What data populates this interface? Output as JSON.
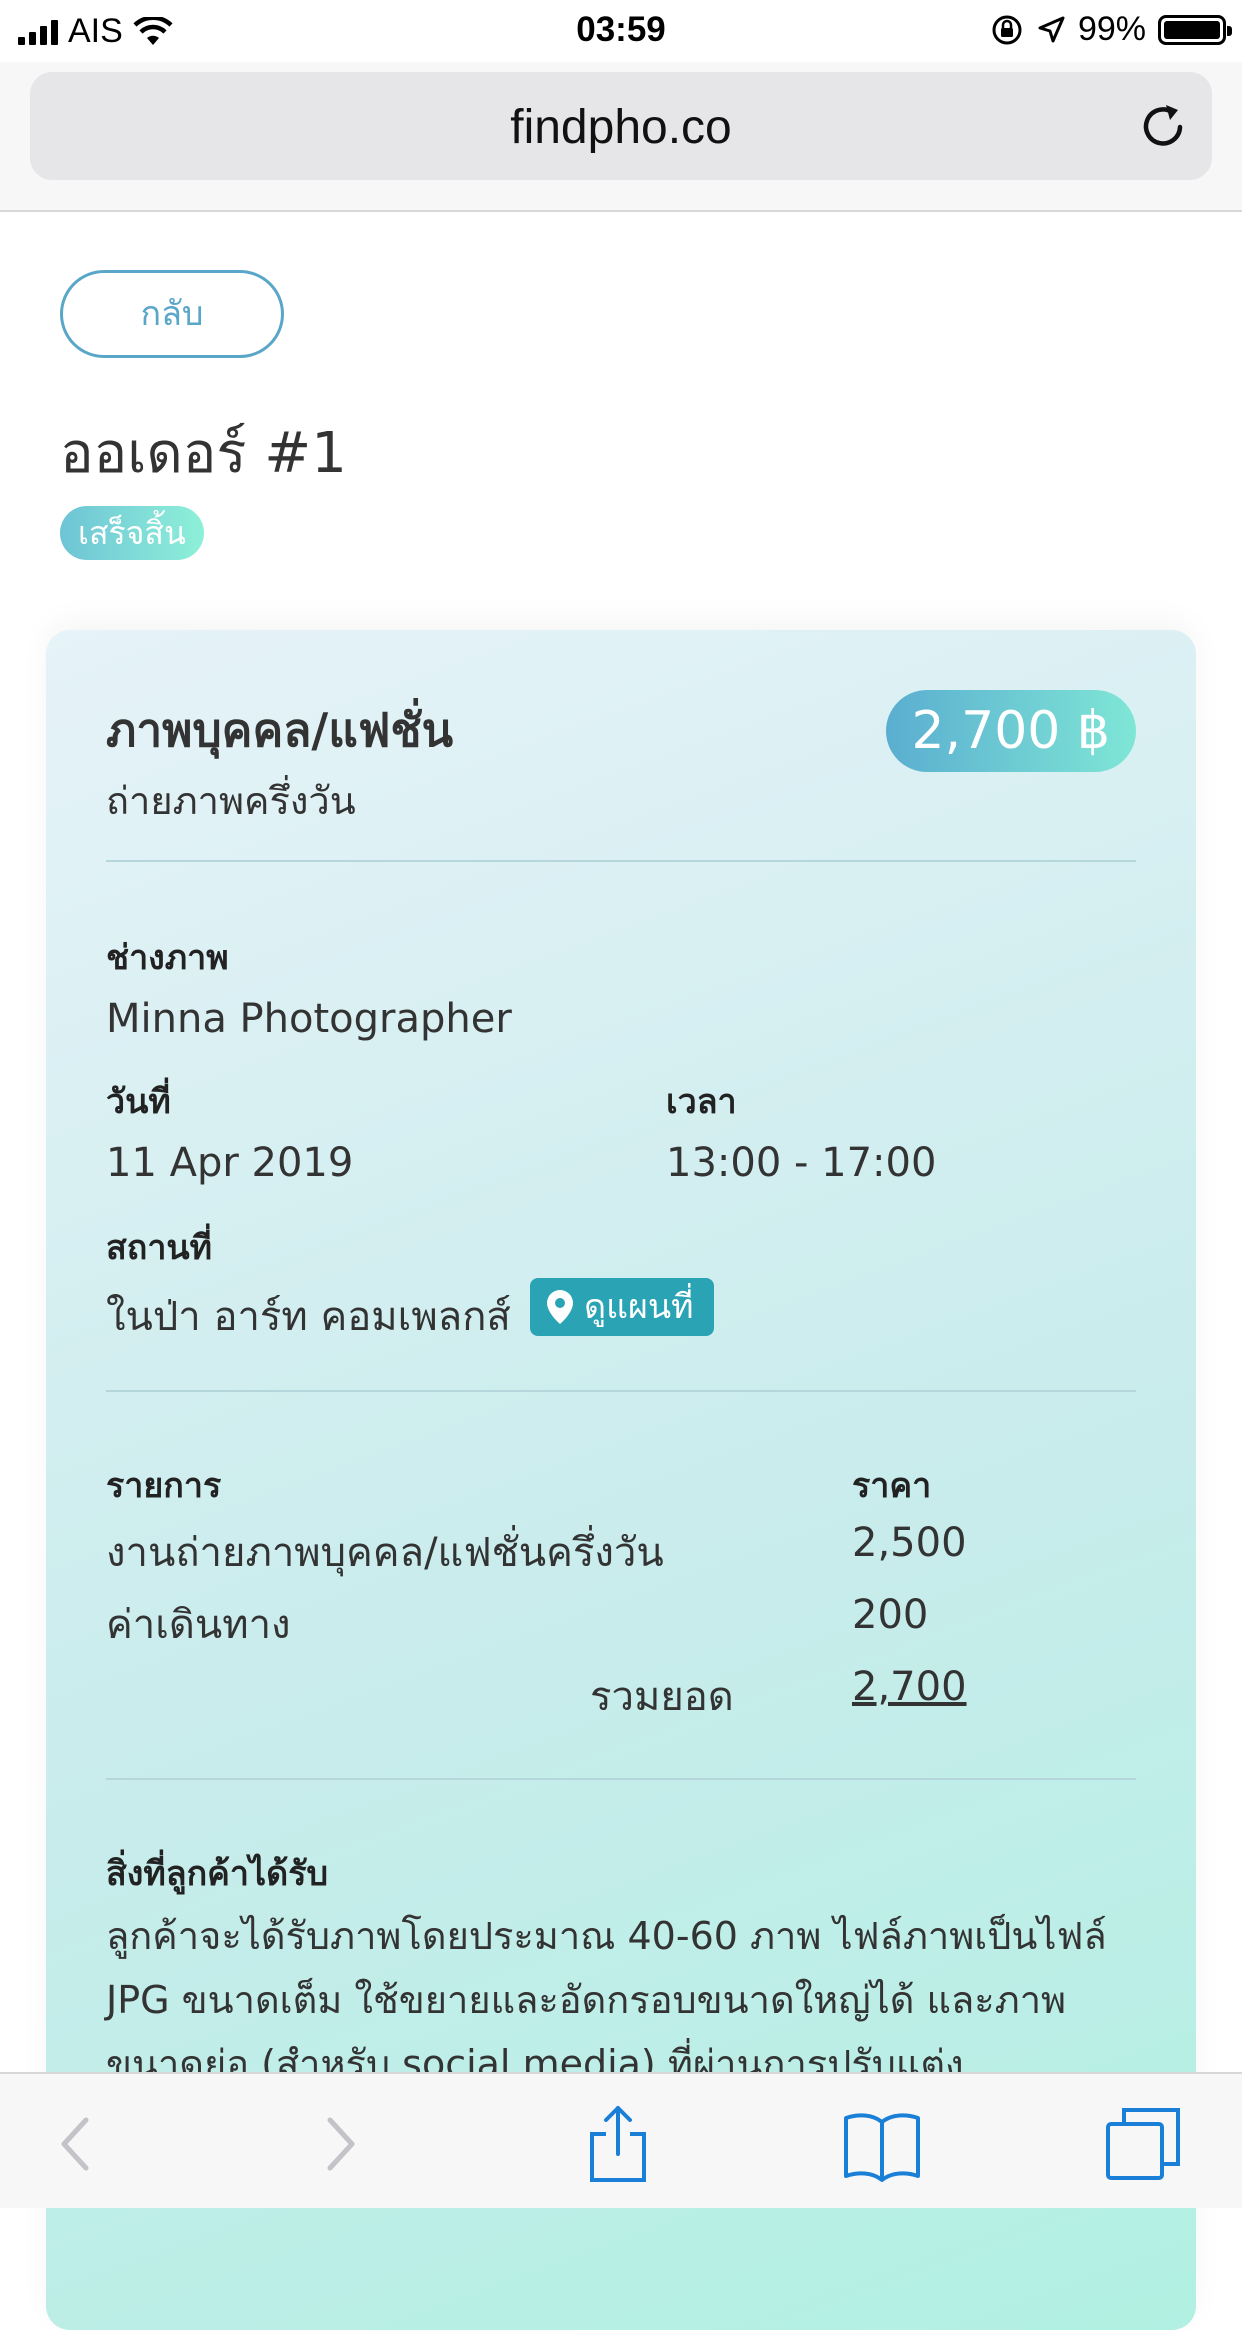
{
  "status_bar": {
    "carrier": "AIS",
    "time": "03:59",
    "battery": "99%"
  },
  "browser": {
    "url": "findpho.co"
  },
  "page": {
    "back_label": "กลับ",
    "order_title": "ออเดอร์ #1",
    "status": "เสร็จสิ้น"
  },
  "card": {
    "title": "ภาพบุคคล/แฟชั่น",
    "subtitle": "ถ่ายภาพครึ่งวัน",
    "price": "2,700 ฿",
    "photographer_label": "ช่างภาพ",
    "photographer": "Minna Photographer",
    "date_label": "วันที่",
    "date": "11 Apr 2019",
    "time_label": "เวลา",
    "time": "13:00 - 17:00",
    "location_label": "สถานที่",
    "location": "ในป่า อาร์ท คอมเพลกส์",
    "map_label": "ดูแผนที่",
    "items_header": "รายการ",
    "price_header": "ราคา",
    "items": [
      {
        "name": "งานถ่ายภาพบุคคล/แฟชั่นครึ่งวัน",
        "price": "2,500"
      },
      {
        "name": "ค่าเดินทาง",
        "price": "200"
      }
    ],
    "total_label": "รวมยอด",
    "total": "2,700",
    "deliverables_label": "สิ่งที่ลูกค้าได้รับ",
    "deliverables_text": "ลูกค้าจะได้รับภาพโดยประมาณ 40-60 ภาพ ไฟล์ภาพเป็นไฟล์ JPG ขนาดเต็ม ใช้ขยายและอัดกรอบขนาดใหญ่ได้ และภาพขนาดย่อ (สำหรับ social media) ที่ผ่านการปรับแต่ง"
  }
}
